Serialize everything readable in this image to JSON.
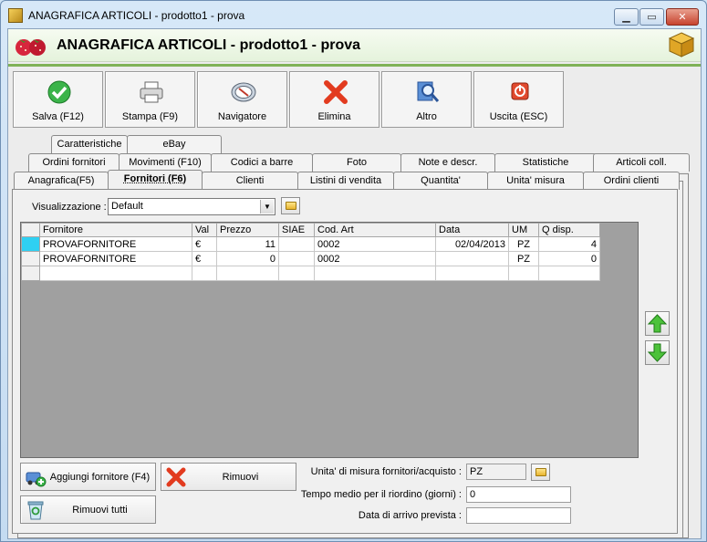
{
  "window": {
    "title": "ANAGRAFICA ARTICOLI - prodotto1 - prova",
    "min_symbol": "▁",
    "max_symbol": "▭",
    "close_symbol": "✕"
  },
  "header": {
    "title": "ANAGRAFICA ARTICOLI - prodotto1 - prova"
  },
  "toolbar": {
    "save_label": "Salva (F12)",
    "print_label": "Stampa (F9)",
    "navigator_label": "Navigatore",
    "delete_label": "Elimina",
    "other_label": "Altro",
    "exit_label": "Uscita (ESC)"
  },
  "tabs": {
    "row3": [
      "Caratteristiche",
      "eBay"
    ],
    "row2": [
      "Ordini fornitori",
      "Movimenti (F10)",
      "Codici a barre",
      "Foto",
      "Note e descr.",
      "Statistiche",
      "Articoli coll."
    ],
    "row1": [
      "Anagrafica(F5)",
      "Fornitori (F6)",
      "Clienti",
      "Listini di vendita",
      "Quantita'",
      "Unita' misura",
      "Ordini clienti"
    ]
  },
  "view": {
    "label": "Visualizzazione :",
    "value": "Default"
  },
  "grid": {
    "columns": [
      "Fornitore",
      "Val",
      "Prezzo",
      "SIAE",
      "Cod. Art",
      "Data",
      "UM",
      "Q disp."
    ],
    "rows": [
      [
        "PROVAFORNITORE",
        "€",
        "11",
        "",
        "0002",
        "02/04/2013",
        "PZ",
        "4"
      ],
      [
        "PROVAFORNITORE",
        "€",
        "0",
        "",
        "0002",
        "",
        "PZ",
        "0"
      ],
      [
        "",
        "",
        "",
        "",
        "",
        "",
        "",
        ""
      ]
    ]
  },
  "buttons": {
    "add_supplier": "Aggiungi fornitore (F4)",
    "remove": "Rimuovi",
    "remove_all": "Rimuovi tutti"
  },
  "form": {
    "um_label": "Unita' di misura fornitori/acquisto :",
    "um_value": "PZ",
    "lead_time_label": "Tempo medio per il riordino (giorni) :",
    "lead_time_value": "0",
    "arrival_label": "Data di arrivo prevista :",
    "arrival_value": ""
  },
  "colors": {
    "accent_green": "#7fb256",
    "selected_row_indicator": "#2fd0f2"
  }
}
